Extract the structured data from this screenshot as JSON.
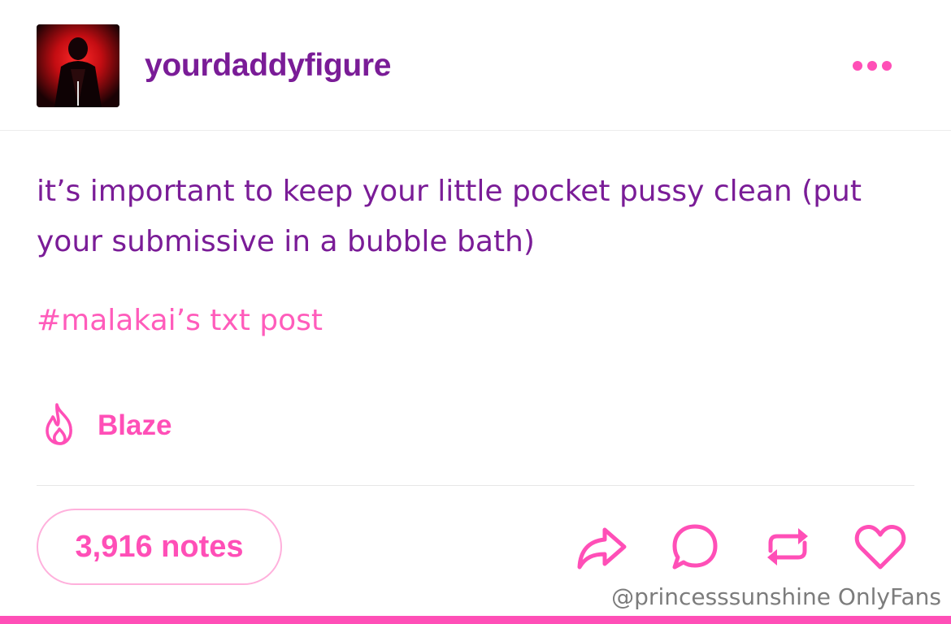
{
  "post": {
    "username": "yourdaddyfigure",
    "body": "it’s important to keep your little pocket pussy clean (put your submissive in a bubble bath)",
    "tag": "#malakai’s txt post",
    "blaze_label": "Blaze",
    "notes_label": "3,916 notes"
  },
  "icons": {
    "more": "more-options-icon",
    "blaze": "flame-icon",
    "share": "share-icon",
    "reply": "reply-icon",
    "reblog": "reblog-icon",
    "like": "heart-icon"
  },
  "colors": {
    "username": "#7a1c97",
    "body_text": "#7a1c97",
    "accent": "#ff4fb7",
    "tag": "#ff5cbb",
    "notes_border": "#ffb0dc",
    "watermark": "#7c7c7c"
  },
  "watermark": "@princesssunshine OnlyFans"
}
